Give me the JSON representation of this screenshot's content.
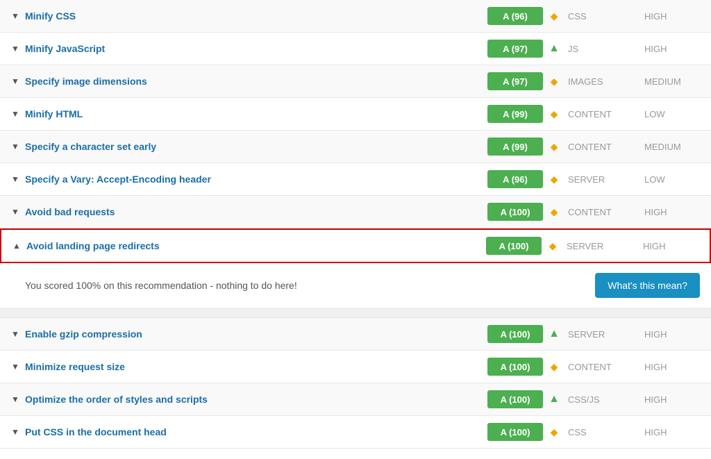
{
  "rows": [
    {
      "id": "minify-css",
      "title": "Minify CSS",
      "score": "A (96)",
      "trend": "diamond",
      "category": "CSS",
      "priority": "HIGH",
      "expanded": false,
      "highlighted": false
    },
    {
      "id": "minify-js",
      "title": "Minify JavaScript",
      "score": "A (97)",
      "trend": "up",
      "category": "JS",
      "priority": "HIGH",
      "expanded": false,
      "highlighted": false
    },
    {
      "id": "specify-image-dimensions",
      "title": "Specify image dimensions",
      "score": "A (97)",
      "trend": "diamond",
      "category": "IMAGES",
      "priority": "MEDIUM",
      "expanded": false,
      "highlighted": false
    },
    {
      "id": "minify-html",
      "title": "Minify HTML",
      "score": "A (99)",
      "trend": "diamond",
      "category": "CONTENT",
      "priority": "LOW",
      "expanded": false,
      "highlighted": false
    },
    {
      "id": "specify-charset-early",
      "title": "Specify a character set early",
      "score": "A (99)",
      "trend": "diamond",
      "category": "CONTENT",
      "priority": "MEDIUM",
      "expanded": false,
      "highlighted": false
    },
    {
      "id": "specify-vary-header",
      "title": "Specify a Vary: Accept-Encoding header",
      "score": "A (96)",
      "trend": "diamond",
      "category": "SERVER",
      "priority": "LOW",
      "expanded": false,
      "highlighted": false
    },
    {
      "id": "avoid-bad-requests",
      "title": "Avoid bad requests",
      "score": "A (100)",
      "trend": "diamond",
      "category": "CONTENT",
      "priority": "HIGH",
      "expanded": false,
      "highlighted": false
    },
    {
      "id": "avoid-landing-redirects",
      "title": "Avoid landing page redirects",
      "score": "A (100)",
      "trend": "diamond",
      "category": "SERVER",
      "priority": "HIGH",
      "expanded": true,
      "highlighted": true,
      "expandedText": "You scored 100% on this recommendation - nothing to do here!",
      "whatsThisLabel": "What's this mean?"
    }
  ],
  "rows2": [
    {
      "id": "enable-gzip",
      "title": "Enable gzip compression",
      "score": "A (100)",
      "trend": "up",
      "category": "SERVER",
      "priority": "HIGH",
      "expanded": false,
      "highlighted": false
    },
    {
      "id": "minimize-request-size",
      "title": "Minimize request size",
      "score": "A (100)",
      "trend": "diamond",
      "category": "CONTENT",
      "priority": "HIGH",
      "expanded": false,
      "highlighted": false
    },
    {
      "id": "optimize-order-styles",
      "title": "Optimize the order of styles and scripts",
      "score": "A (100)",
      "trend": "up",
      "category": "CSS/JS",
      "priority": "HIGH",
      "expanded": false,
      "highlighted": false
    },
    {
      "id": "put-css-head",
      "title": "Put CSS in the document head",
      "score": "A (100)",
      "trend": "diamond",
      "category": "CSS",
      "priority": "HIGH",
      "expanded": false,
      "highlighted": false
    }
  ]
}
